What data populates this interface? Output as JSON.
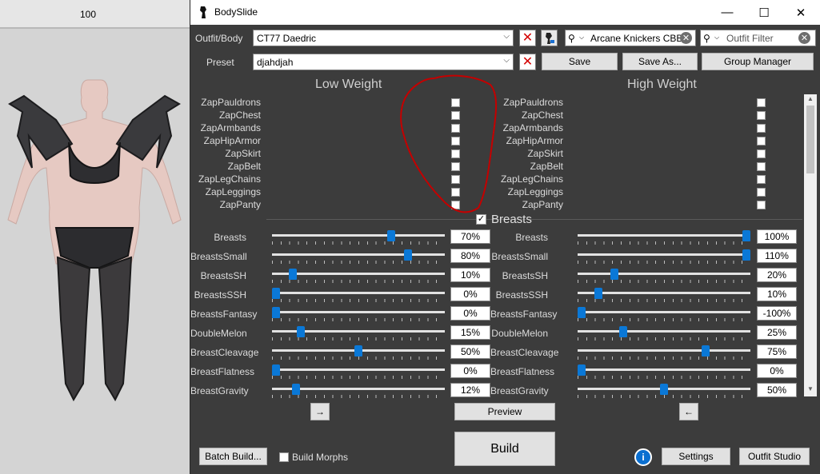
{
  "preview": {
    "zoom": "100"
  },
  "window": {
    "title": "BodySlide",
    "controls": {
      "minimize": "—",
      "maximize": "☐",
      "close": "✕"
    }
  },
  "outfit": {
    "label": "Outfit/Body",
    "value": "CT77 Daedric",
    "search_value": "Arcane Knickers CBB",
    "filter_placeholder": "Outfit Filter"
  },
  "preset": {
    "label": "Preset",
    "value": "djahdjah"
  },
  "buttons": {
    "save": "Save",
    "save_as": "Save As...",
    "group_manager": "Group Manager",
    "preview": "Preview",
    "build": "Build",
    "batch_build": "Batch Build...",
    "settings": "Settings",
    "outfit_studio": "Outfit Studio",
    "arrow_right": "→",
    "arrow_left": "←",
    "clear": "✕",
    "dropdown": "⌵",
    "info": "i",
    "close_x": "✕"
  },
  "headers": {
    "low": "Low Weight",
    "high": "High Weight"
  },
  "zaps": [
    "ZapPauldrons",
    "ZapChest",
    "ZapArmbands",
    "ZapHipArmor",
    "ZapSkirt",
    "ZapBelt",
    "ZapLegChains",
    "ZapLeggings",
    "ZapPanty"
  ],
  "section": {
    "name": "Breasts",
    "checked": "✓"
  },
  "sliders": [
    {
      "name": "Breasts",
      "low_value": "70%",
      "high_value": "100%",
      "low_pos": 0.7,
      "high_pos": 1.0
    },
    {
      "name": "BreastsSmall",
      "low_value": "80%",
      "high_value": "110%",
      "low_pos": 0.8,
      "high_pos": 1.0
    },
    {
      "name": "BreastsSH",
      "low_value": "10%",
      "high_value": "20%",
      "low_pos": 0.1,
      "high_pos": 0.2
    },
    {
      "name": "BreastsSSH",
      "low_value": "0%",
      "high_value": "10%",
      "low_pos": 0.0,
      "high_pos": 0.1
    },
    {
      "name": "BreastsFantasy",
      "low_value": "0%",
      "high_value": "-100%",
      "low_pos": 0.0,
      "high_pos": 0.0
    },
    {
      "name": "DoubleMelon",
      "low_value": "15%",
      "high_value": "25%",
      "low_pos": 0.15,
      "high_pos": 0.25
    },
    {
      "name": "BreastCleavage",
      "low_value": "50%",
      "high_value": "75%",
      "low_pos": 0.5,
      "high_pos": 0.75
    },
    {
      "name": "BreastFlatness",
      "low_value": "0%",
      "high_value": "0%",
      "low_pos": 0.0,
      "high_pos": 0.0
    },
    {
      "name": "BreastGravity",
      "low_value": "12%",
      "high_value": "50%",
      "low_pos": 0.12,
      "high_pos": 0.5
    }
  ],
  "build_morphs": "Build Morphs",
  "colors": {
    "accent": "#0a78d7",
    "annotation": "#c40000",
    "window_bg": "#3c3c3c"
  }
}
